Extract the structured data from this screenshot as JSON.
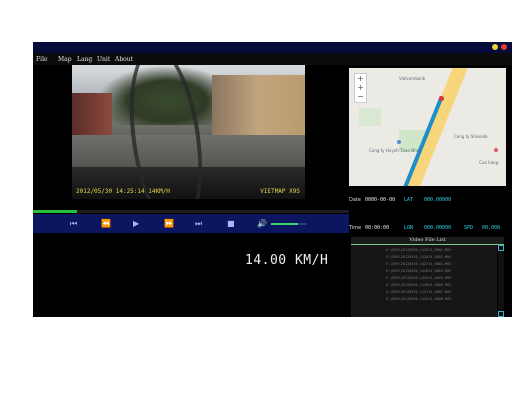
{
  "menu": [
    "File",
    "Map",
    "Lang",
    "Unit",
    "About"
  ],
  "video": {
    "osd_left": "2012/05/30 14:25:14 14KM/H",
    "osd_right": "VIETMAP X9S"
  },
  "map": {
    "labels": [
      "Vietcombank",
      "Cong ty Huynh Than Nhat",
      "Cong ty Shiseido",
      "Cua hang"
    ]
  },
  "info": {
    "date_label": "Date",
    "date_value": "0000-00-00",
    "lat_label": "LAT",
    "lat_value": "000.00000",
    "time_label": "Time",
    "time_value": "00:00:00",
    "lon_label": "LON",
    "lon_value": "000.00000",
    "spd_label": "SPD",
    "spd_value": "00.000"
  },
  "playback": {
    "progress_fraction": 0.14,
    "volume_fraction": 0.75
  },
  "speed_display": "14.00 KM/H",
  "file_list": {
    "title": "Video File List",
    "items": [
      "E:\\DVR\\20120530_142514_0001.MOV",
      "E:\\DVR\\20120530_142614_0002.MOV",
      "E:\\DVR\\20120530_142714_0003.MOV",
      "E:\\DVR\\20120530_142814_0004.MOV",
      "E:\\DVR\\20120530_142914_0005.MOV",
      "E:\\DVR\\20120530_143014_0006.MOV",
      "E:\\DVR\\20120530_143114_0007.MOV",
      "E:\\DVR\\20120530_143214_0008.MOV"
    ]
  },
  "icons": {
    "prev": "skip-start-icon",
    "rewind": "rewind-icon",
    "play": "play-icon",
    "forward": "fast-forward-icon",
    "next": "skip-end-icon",
    "stop": "stop-icon",
    "volume": "volume-icon"
  },
  "colors": {
    "titlebar": "#070b3a",
    "controls": "#0b1560",
    "accent_cyan": "#2fd0e8",
    "progress_green": "#27c23a"
  }
}
